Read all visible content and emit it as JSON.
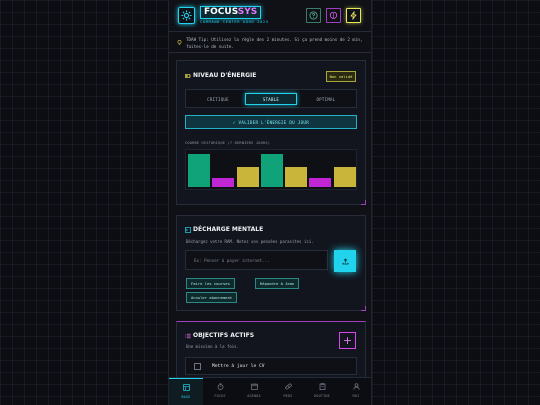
{
  "header": {
    "brand_main": "FOCUS",
    "brand_accent": "SYS",
    "brand_tagline": "COMMAND CENTER ADHD 2025",
    "buttons": [
      {
        "icon": "question-icon"
      },
      {
        "icon": "brain-icon"
      },
      {
        "icon": "bolt-icon"
      }
    ]
  },
  "tip": {
    "icon": "lightbulb-icon",
    "text": "TDAH Tip: Utilisez la règle des 2 minutes. Si ça prend moins de 2 min, faites-le de suite."
  },
  "energy": {
    "title": "NIVEAU D'ÉNERGIE",
    "badge": "Non validé",
    "options": [
      "CRITIQUE",
      "STABLE",
      "OPTIMAL"
    ],
    "selected": "STABLE",
    "validate_label": "✓  VALIDER L'ÉNERGIE DU JOUR",
    "history_label": "COURBE HISTORIQUE (7 DERNIERS JOURS)",
    "history_levels": [
      "OPTIMAL",
      "CRITIQUE",
      "STABLE",
      "OPTIMAL",
      "STABLE",
      "CRITIQUE",
      "STABLE"
    ],
    "colors": {
      "OPTIMAL": "#10a37a",
      "STABLE": "#c9b53a",
      "CRITIQUE": "#c026d3"
    }
  },
  "mental": {
    "title": "DÉCHARGE MENTALE",
    "subtitle": "Déchargez votre RAM. Notez vos pensées parasites ici.",
    "placeholder": "Ex: Penser à payer internet...",
    "chips": [
      "Faire les courses",
      "Répondre à Jean",
      "Annuler abonnement"
    ]
  },
  "objectives": {
    "title": "OBJECTIFS ACTIFS",
    "subtitle": "Une mission à la fois.",
    "tasks": [
      "Mettre à jour le CV"
    ]
  },
  "nav": {
    "items": [
      {
        "label": "BASE",
        "icon": "dashboard-icon",
        "active": true
      },
      {
        "label": "FOCUS",
        "icon": "timer-icon",
        "active": false
      },
      {
        "label": "AGENDA",
        "icon": "calendar-icon",
        "active": false
      },
      {
        "label": "MEDS",
        "icon": "pill-icon",
        "active": false
      },
      {
        "label": "ROUTINE",
        "icon": "clipboard-icon",
        "active": false
      },
      {
        "label": "MOI",
        "icon": "user-icon",
        "active": false
      }
    ]
  }
}
